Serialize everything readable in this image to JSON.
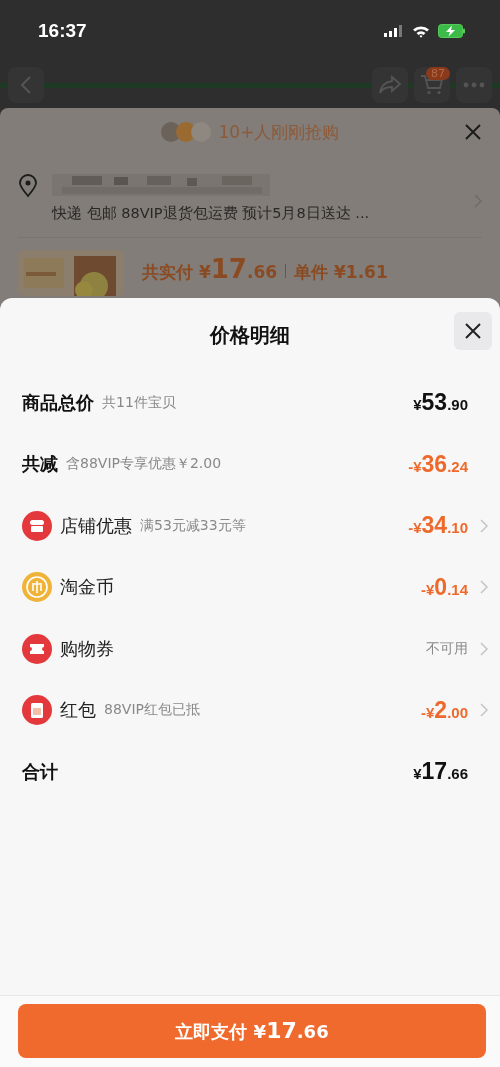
{
  "status_bar": {
    "time": "16:37"
  },
  "background_page": {
    "cart_badge": "87",
    "banner": "10+人刚刚抢购",
    "shipping": "快递 包邮 88VIP退货包运费 预计5月8日送达 ...",
    "product": {
      "paid_label": "共实付",
      "paid_currency": "¥",
      "paid_whole": "17",
      "paid_fraction": ".66",
      "unit_label": "单件",
      "unit_price": "¥1.61"
    }
  },
  "sheet": {
    "title": "价格明细",
    "rows": [
      {
        "kind": "plain",
        "label": "商品总价",
        "strong": true,
        "note": "共11件宝贝",
        "discount": false,
        "value": {
          "currency": "¥",
          "whole": "53",
          "fraction": ".90"
        },
        "chevron": false
      },
      {
        "kind": "plain",
        "label": "共减",
        "strong": true,
        "note": "含88VIP专享优惠￥2.00",
        "discount": true,
        "value": {
          "currency": "-¥",
          "whole": "36",
          "fraction": ".24"
        },
        "chevron": false
      },
      {
        "kind": "shop",
        "label": "店铺优惠",
        "strong": false,
        "note": "满53元减33元等",
        "discount": true,
        "value": {
          "currency": "-¥",
          "whole": "34",
          "fraction": ".10"
        },
        "chevron": true
      },
      {
        "kind": "coin",
        "label": "淘金币",
        "strong": false,
        "discount": true,
        "value": {
          "currency": "-¥",
          "whole": "0",
          "fraction": ".14"
        },
        "chevron": true
      },
      {
        "kind": "ticket",
        "label": "购物券",
        "strong": false,
        "value_text": "不可用",
        "chevron": true
      },
      {
        "kind": "envelope",
        "label": "红包",
        "strong": false,
        "note": "88VIP红包已抵",
        "discount": true,
        "value": {
          "currency": "-¥",
          "whole": "2",
          "fraction": ".00"
        },
        "chevron": true
      },
      {
        "kind": "plain",
        "label": "合计",
        "strong": true,
        "discount": false,
        "value": {
          "currency": "¥",
          "whole": "17",
          "fraction": ".66"
        },
        "chevron": false
      }
    ],
    "pay_button": {
      "label": "立即支付",
      "currency": "¥",
      "whole": "17",
      "fraction": ".66"
    }
  }
}
